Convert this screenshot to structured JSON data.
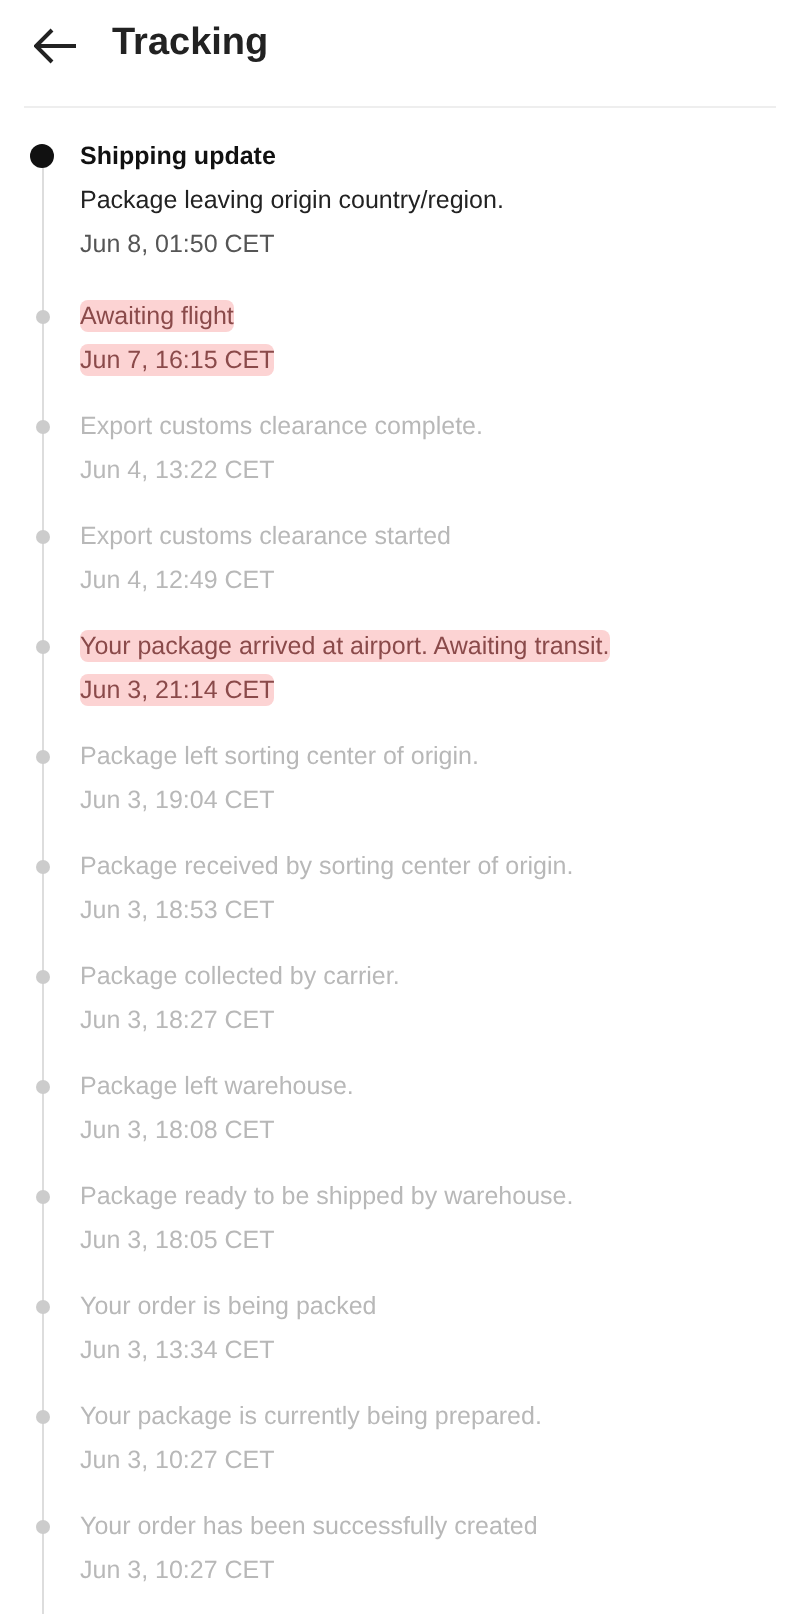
{
  "header": {
    "title": "Tracking"
  },
  "events": [
    {
      "title": "Shipping update",
      "detail": "Package leaving origin country/region.",
      "time": "Jun 8, 01:50 CET",
      "current": true,
      "highlighted": false
    },
    {
      "title": "Awaiting flight",
      "time": "Jun 7, 16:15 CET",
      "current": false,
      "highlighted": true
    },
    {
      "title": "Export customs clearance complete.",
      "time": "Jun 4, 13:22 CET",
      "current": false,
      "highlighted": false
    },
    {
      "title": "Export customs clearance started",
      "time": "Jun 4, 12:49 CET",
      "current": false,
      "highlighted": false
    },
    {
      "title": "Your package arrived at airport. Awaiting transit.",
      "time": "Jun 3, 21:14 CET",
      "current": false,
      "highlighted": true
    },
    {
      "title": "Package left sorting center of origin.",
      "time": "Jun 3, 19:04 CET",
      "current": false,
      "highlighted": false
    },
    {
      "title": "Package received by sorting center of origin.",
      "time": "Jun 3, 18:53 CET",
      "current": false,
      "highlighted": false
    },
    {
      "title": "Package collected by carrier.",
      "time": "Jun 3, 18:27 CET",
      "current": false,
      "highlighted": false
    },
    {
      "title": "Package left warehouse.",
      "time": "Jun 3, 18:08 CET",
      "current": false,
      "highlighted": false
    },
    {
      "title": "Package ready to be shipped by warehouse.",
      "time": "Jun 3, 18:05 CET",
      "current": false,
      "highlighted": false
    },
    {
      "title": "Your order is being packed",
      "time": "Jun 3, 13:34 CET",
      "current": false,
      "highlighted": false
    },
    {
      "title": "Your package is currently being prepared.",
      "time": "Jun 3, 10:27 CET",
      "current": false,
      "highlighted": false
    },
    {
      "title": "Your order has been successfully created",
      "time": "Jun 3, 10:27 CET",
      "current": false,
      "highlighted": false
    }
  ]
}
